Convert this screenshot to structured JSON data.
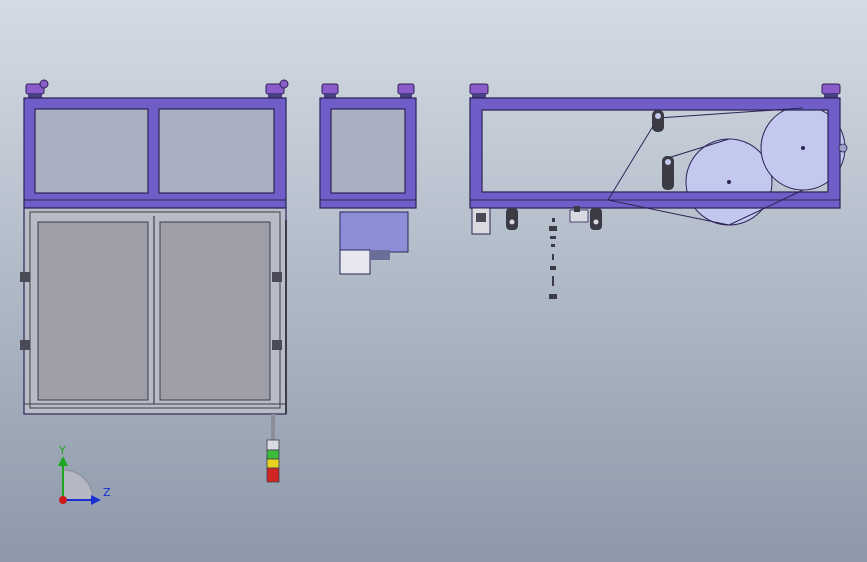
{
  "viewport": {
    "background_top": "#d5dbe4",
    "background_bottom": "#8d99a9"
  },
  "colors": {
    "frame_purple": "#6f5ec7",
    "frame_outline": "#2c2456",
    "foot_purple": "#8a5cc9",
    "panel_gray": "#9d9ea8",
    "motor_block": "#8c8fd8",
    "roller_fill": "#c3c8ee",
    "beacon_green": "#3dbb3d",
    "beacon_yellow": "#e7d21e",
    "beacon_red": "#d32424",
    "axis_y": "#1fa51f",
    "axis_z": "#1a2fd0",
    "axis_origin": "#d01a1a"
  },
  "views": {
    "front": {
      "label": "front-view",
      "panels": 2
    },
    "side": {
      "label": "side-view",
      "panels": 1
    },
    "top": {
      "label": "top-view",
      "rollers": 3
    }
  },
  "triad": {
    "y_label": "Y",
    "z_label": "Z",
    "icon": "coordinate-triad-icon"
  }
}
